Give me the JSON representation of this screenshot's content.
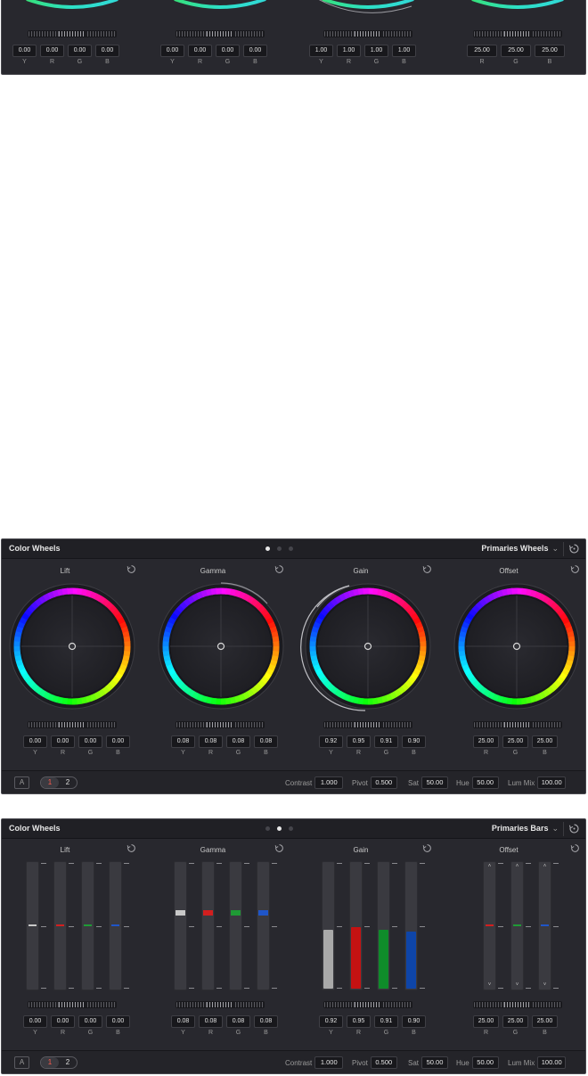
{
  "top_crop": {
    "groups": [
      {
        "values": [
          "0.00",
          "0.00",
          "0.00",
          "0.00"
        ],
        "labels": [
          "Y",
          "R",
          "G",
          "B"
        ]
      },
      {
        "values": [
          "0.00",
          "0.00",
          "0.00",
          "0.00"
        ],
        "labels": [
          "Y",
          "R",
          "G",
          "B"
        ]
      },
      {
        "values": [
          "1.00",
          "1.00",
          "1.00",
          "1.00"
        ],
        "labels": [
          "Y",
          "R",
          "G",
          "B"
        ]
      },
      {
        "values": [
          "25.00",
          "25.00",
          "25.00"
        ],
        "labels": [
          "R",
          "G",
          "B"
        ]
      }
    ]
  },
  "wheels_panel": {
    "title": "Color Wheels",
    "mode": "Primaries Wheels",
    "active_page_dot": 0,
    "columns": [
      {
        "name": "Lift",
        "values": [
          "0.00",
          "0.00",
          "0.00",
          "0.00"
        ],
        "labels": [
          "Y",
          "R",
          "G",
          "B"
        ]
      },
      {
        "name": "Gamma",
        "values": [
          "0.08",
          "0.08",
          "0.08",
          "0.08"
        ],
        "labels": [
          "Y",
          "R",
          "G",
          "B"
        ]
      },
      {
        "name": "Gain",
        "values": [
          "0.92",
          "0.95",
          "0.91",
          "0.90"
        ],
        "labels": [
          "Y",
          "R",
          "G",
          "B"
        ]
      },
      {
        "name": "Offset",
        "values": [
          "25.00",
          "25.00",
          "25.00"
        ],
        "labels": [
          "R",
          "G",
          "B"
        ]
      }
    ],
    "footer": {
      "a_label": "A",
      "page1": "1",
      "page2": "2",
      "contrast_label": "Contrast",
      "contrast": "1.000",
      "pivot_label": "Pivot",
      "pivot": "0.500",
      "sat_label": "Sat",
      "sat": "50.00",
      "hue_label": "Hue",
      "hue": "50.00",
      "lummix_label": "Lum Mix",
      "lummix": "100.00"
    }
  },
  "bars_panel": {
    "title": "Color Wheels",
    "mode": "Primaries Bars",
    "active_page_dot": 1,
    "columns": [
      {
        "name": "Lift",
        "values": [
          "0.00",
          "0.00",
          "0.00",
          "0.00"
        ],
        "labels": [
          "Y",
          "R",
          "G",
          "B"
        ],
        "bar_levels": [
          0.5,
          0.5,
          0.5,
          0.5
        ],
        "style": "marker"
      },
      {
        "name": "Gamma",
        "values": [
          "0.08",
          "0.08",
          "0.08",
          "0.08"
        ],
        "labels": [
          "Y",
          "R",
          "G",
          "B"
        ],
        "bar_levels": [
          0.58,
          0.58,
          0.58,
          0.58
        ],
        "style": "marker"
      },
      {
        "name": "Gain",
        "values": [
          "0.92",
          "0.95",
          "0.91",
          "0.90"
        ],
        "labels": [
          "Y",
          "R",
          "G",
          "B"
        ],
        "bar_levels": [
          0.46,
          0.48,
          0.46,
          0.45
        ],
        "style": "fill"
      },
      {
        "name": "Offset",
        "values": [
          "25.00",
          "25.00",
          "25.00"
        ],
        "labels": [
          "R",
          "G",
          "B"
        ],
        "bar_levels": [
          0.5,
          0.5,
          0.5
        ],
        "style": "marker"
      }
    ],
    "bar_colors": {
      "Y": "#c8c8c8",
      "R": "#d21f1f",
      "G": "#1f9a35",
      "B": "#1f55c8"
    },
    "fill_colors": {
      "Y": "#a9a9a9",
      "R": "#c41212",
      "G": "#0f8c2a",
      "B": "#0e45a8"
    },
    "footer": {
      "a_label": "A",
      "page1": "1",
      "page2": "2",
      "contrast_label": "Contrast",
      "contrast": "1.000",
      "pivot_label": "Pivot",
      "pivot": "0.500",
      "sat_label": "Sat",
      "sat": "50.00",
      "hue_label": "Hue",
      "hue": "50.00",
      "lummix_label": "Lum Mix",
      "lummix": "100.00"
    }
  }
}
